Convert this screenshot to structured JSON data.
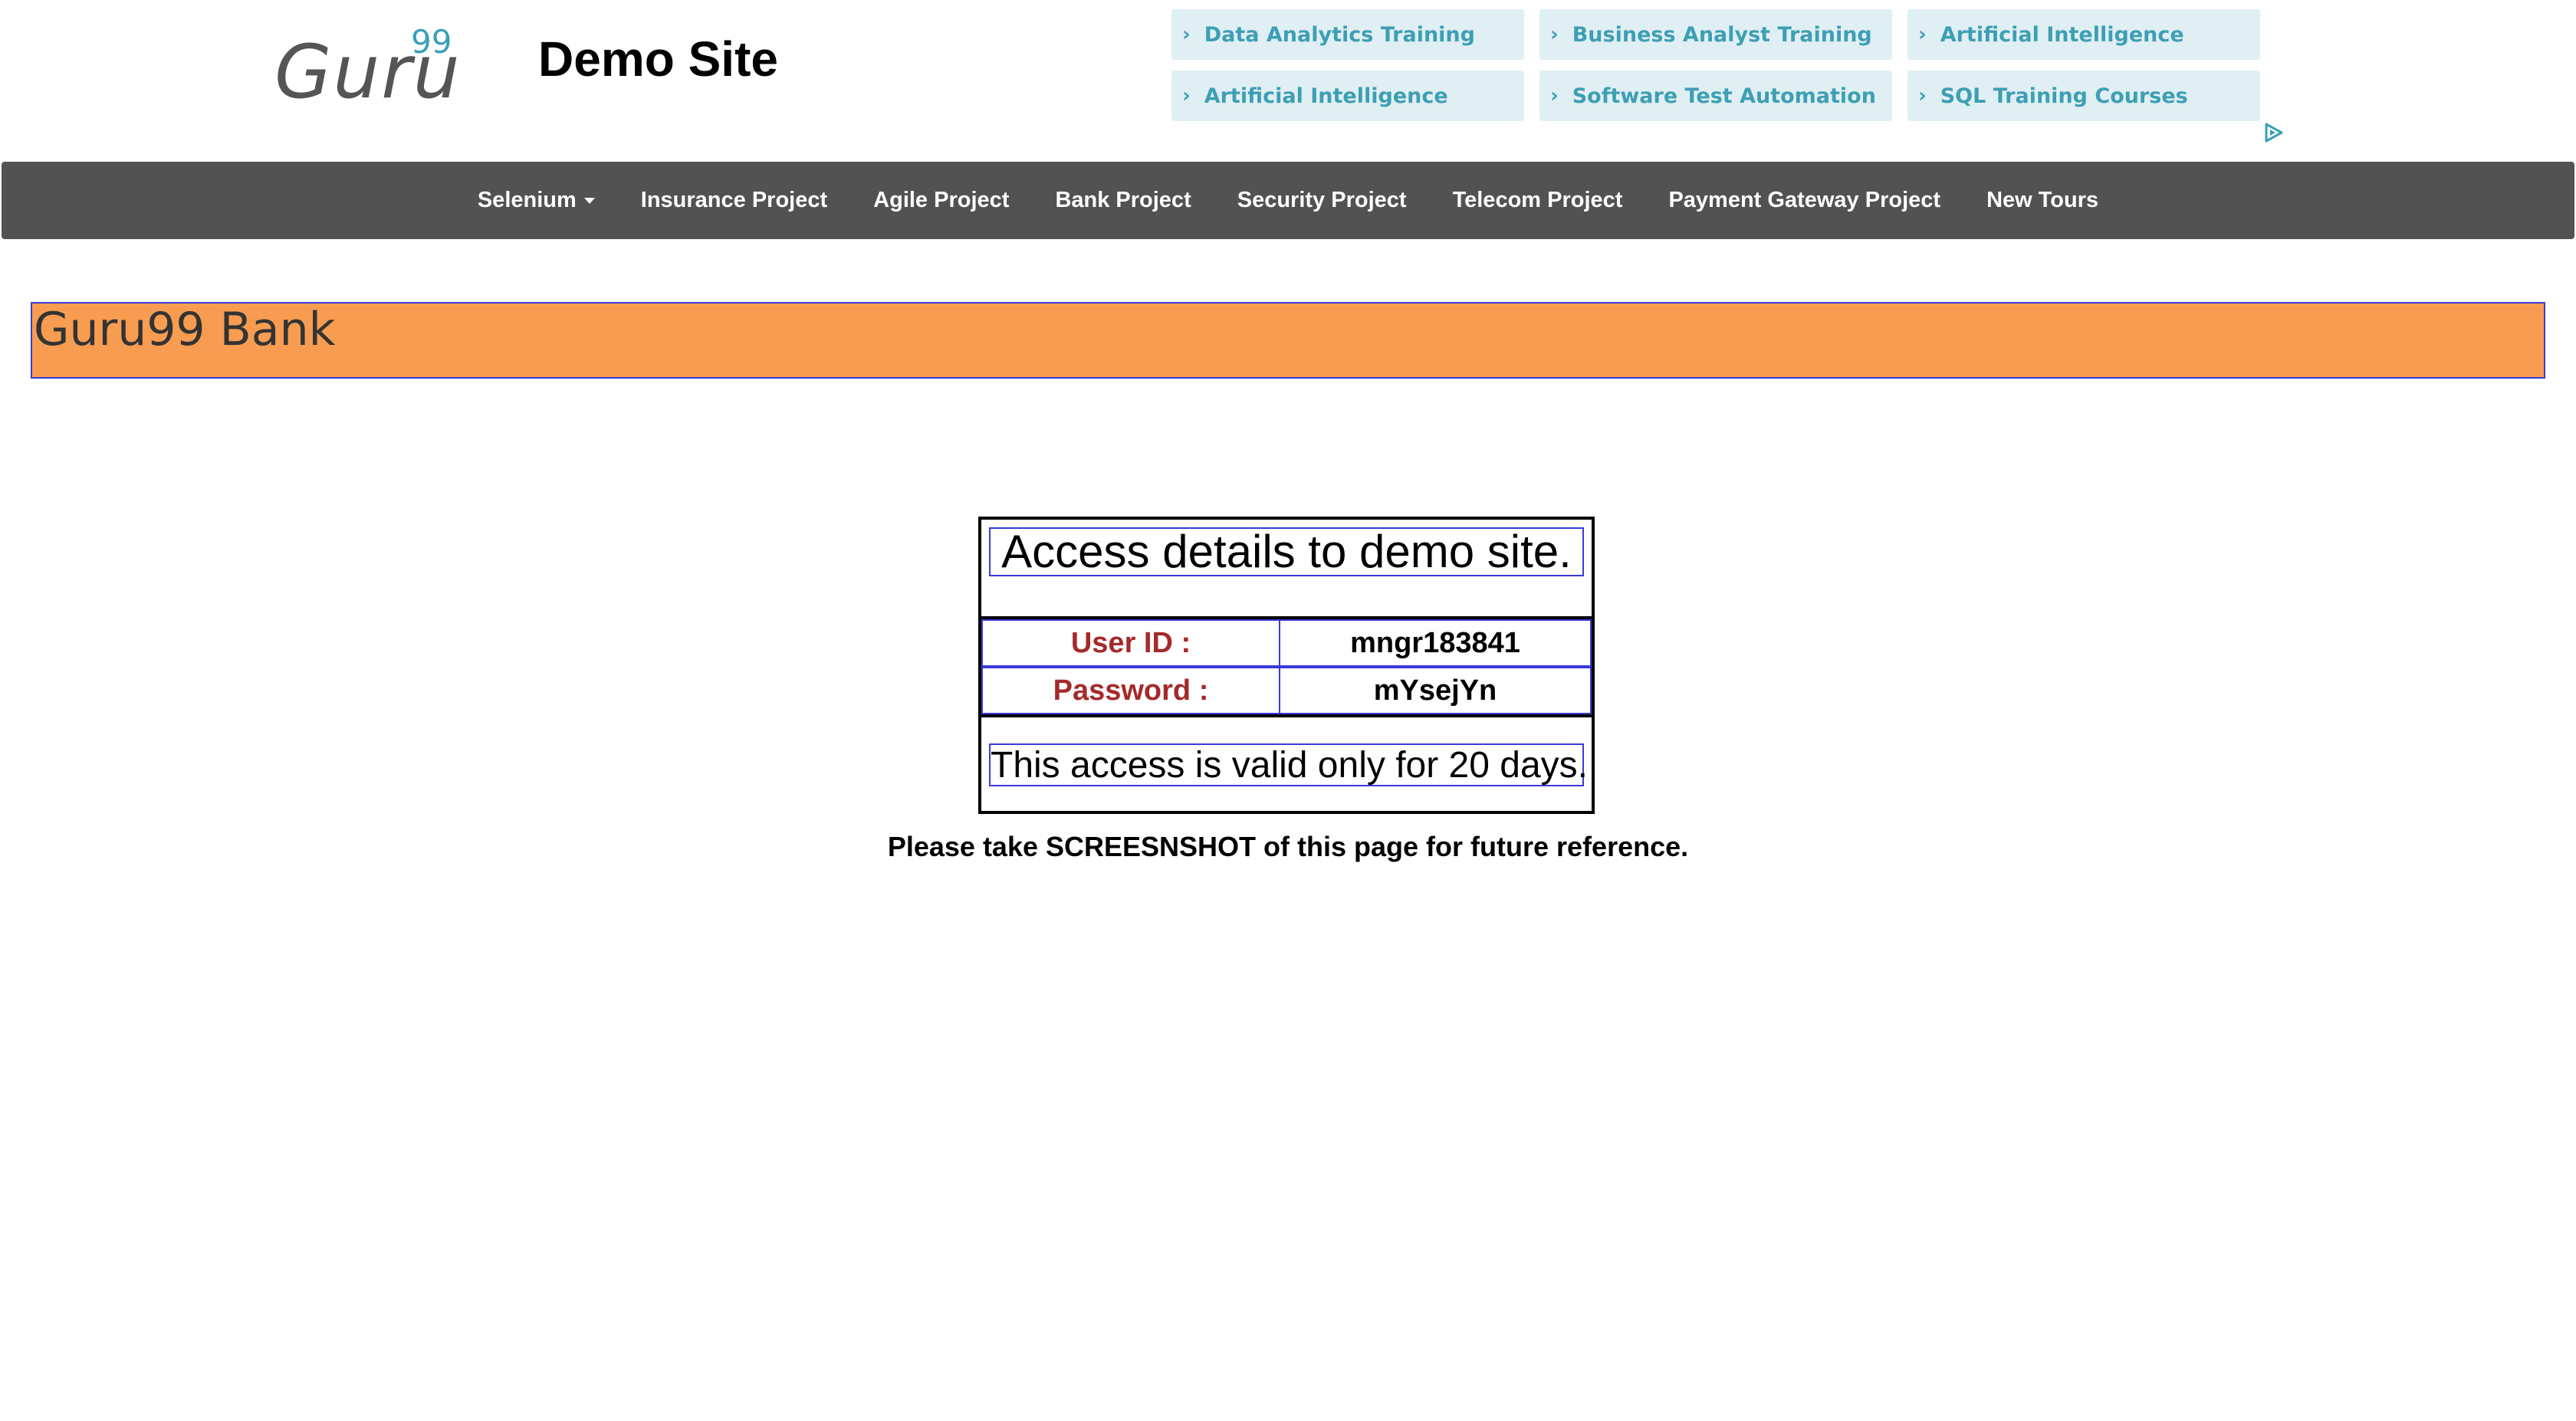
{
  "header": {
    "logo_text": "Guru",
    "logo_sup": "99",
    "site_title": "Demo Site"
  },
  "ad_links": [
    {
      "label": "Data Analytics Training"
    },
    {
      "label": "Business Analyst Training"
    },
    {
      "label": "Artificial Intelligence"
    },
    {
      "label": "Artificial Intelligence"
    },
    {
      "label": "Software Test Automation"
    },
    {
      "label": "SQL Training Courses"
    }
  ],
  "nav": {
    "items": [
      {
        "label": "Selenium"
      },
      {
        "label": "Insurance Project"
      },
      {
        "label": "Agile Project"
      },
      {
        "label": "Bank Project"
      },
      {
        "label": "Security Project"
      },
      {
        "label": "Telecom Project"
      },
      {
        "label": "Payment Gateway Project"
      },
      {
        "label": "New Tours"
      }
    ]
  },
  "banner": {
    "title": "Guru99 Bank"
  },
  "access": {
    "heading": "Access details to demo site.",
    "user_id_label": "User ID :",
    "user_id_value": "mngr183841",
    "password_label": "Password :",
    "password_value": "mYsejYn",
    "validity": "This access is valid only for 20 days."
  },
  "note": "Please take SCREESNSHOT of this page for future reference.",
  "colors": {
    "nav_bg": "#525252",
    "banner_bg": "#f79c51",
    "ad_bg": "#e0eff3",
    "ad_text": "#3d9fb4",
    "label_red": "#a52a2a",
    "border_blue": "#3a3ad8"
  },
  "icons": {
    "ad_chevron": "chevron-right-icon",
    "adchoices": "adchoices-icon",
    "nav_caret": "caret-down-icon"
  }
}
